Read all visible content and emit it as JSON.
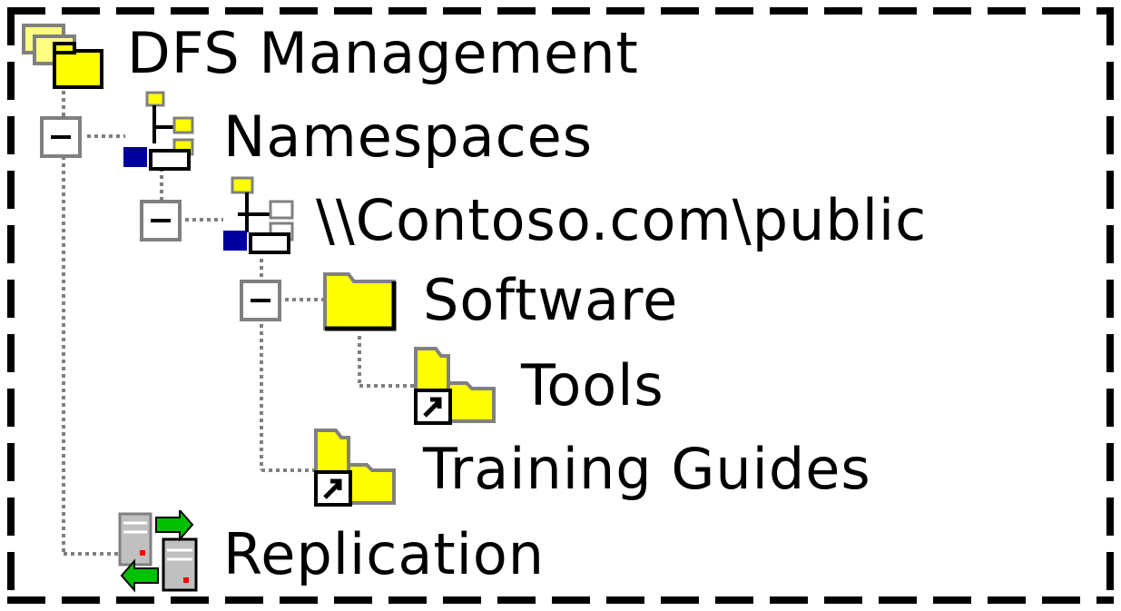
{
  "tree": {
    "root": {
      "label": "DFS Management",
      "icon": "dfs-management-icon"
    },
    "namespaces": {
      "label": "Namespaces",
      "icon": "namespaces-icon",
      "expanded": true
    },
    "namespace": {
      "label": "\\\\Contoso.com\\public",
      "icon": "namespace-root-icon",
      "expanded": true
    },
    "software": {
      "label": "Software",
      "icon": "folder-icon",
      "expanded": true
    },
    "tools": {
      "label": "Tools",
      "icon": "folder-link-icon"
    },
    "training": {
      "label": "Training Guides",
      "icon": "folder-link-icon"
    },
    "replication": {
      "label": "Replication",
      "icon": "replication-icon"
    }
  },
  "colors": {
    "folder_yellow": "#ffff00",
    "tree_line": "#808080",
    "blue": "#0000a0",
    "green": "#00c000"
  }
}
